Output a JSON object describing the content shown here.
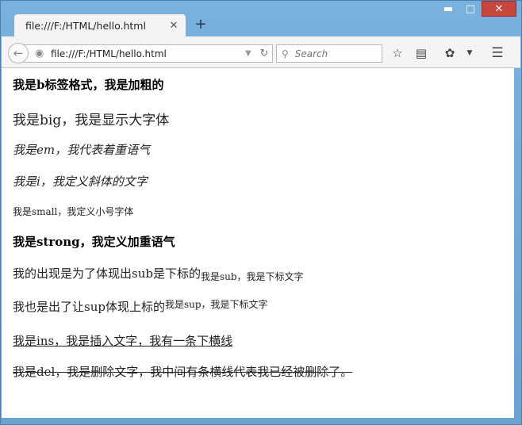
{
  "tab": {
    "title": "file:///F:/HTML/hello.html"
  },
  "toolbar": {
    "url": "file:///F:/HTML/hello.html",
    "search_placeholder": "Search"
  },
  "content": {
    "b_text": "我是b标签格式，我是加粗的",
    "big_text": "我是big，我是显示大字体",
    "em_text": "我是em，我代表着重语气",
    "i_text": "我是i，我定义斜体的文字",
    "small_text": "我是small，我定义小号字体",
    "strong_text": "我是strong，我定义加重语气",
    "sub_main": "我的出现是为了体现出sub是下标的",
    "sub_text": "我是sub，我是下标文字",
    "sup_main": "我也是出了让sup体现上标的",
    "sup_text": "我是sup，我是下标文字",
    "ins_text": "我是ins，我是插入文字，我有一条下横线",
    "del_text": "我是del，我是删除文字，我中间有条横线代表我已经被删除了。"
  },
  "colors": {
    "titlebar": "#6fa8d6",
    "close": "#c7463d"
  }
}
